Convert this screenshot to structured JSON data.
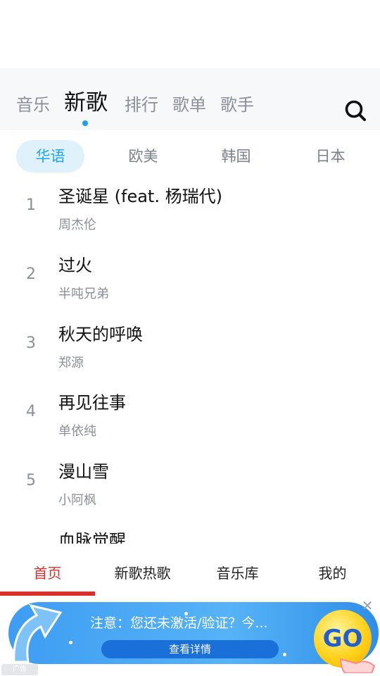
{
  "top_tabs": [
    {
      "label": "音乐",
      "active": false
    },
    {
      "label": "新歌",
      "active": true
    },
    {
      "label": "排行",
      "active": false
    },
    {
      "label": "歌单",
      "active": false
    },
    {
      "label": "歌手",
      "active": false
    }
  ],
  "search_icon": "search-icon",
  "regions": [
    {
      "label": "华语",
      "active": true
    },
    {
      "label": "欧美",
      "active": false
    },
    {
      "label": "韩国",
      "active": false
    },
    {
      "label": "日本",
      "active": false
    }
  ],
  "songs": [
    {
      "rank": "1",
      "title": "圣诞星 (feat. 杨瑞代)",
      "artist": "周杰伦"
    },
    {
      "rank": "2",
      "title": "过火",
      "artist": "半吨兄弟"
    },
    {
      "rank": "3",
      "title": "秋天的呼唤",
      "artist": "郑源"
    },
    {
      "rank": "4",
      "title": "再见往事",
      "artist": "单依纯"
    },
    {
      "rank": "5",
      "title": "漫山雪",
      "artist": "小阿枫"
    },
    {
      "rank": "",
      "title": "血脉觉醒",
      "artist": ""
    }
  ],
  "bottom_nav": [
    {
      "label": "首页",
      "active": true
    },
    {
      "label": "新歌热歌",
      "active": false
    },
    {
      "label": "音乐库",
      "active": false
    },
    {
      "label": "我的",
      "active": false
    }
  ],
  "ad": {
    "notice": "注意：您还未激活/验证？今...",
    "detail_button": "查看详情",
    "go_label": "GO",
    "ad_label": "广告",
    "close_icon": "close-icon"
  },
  "colors": {
    "accent": "#1aa3e6",
    "nav_active": "#d9302b",
    "region_active_bg": "#dff2fc"
  }
}
